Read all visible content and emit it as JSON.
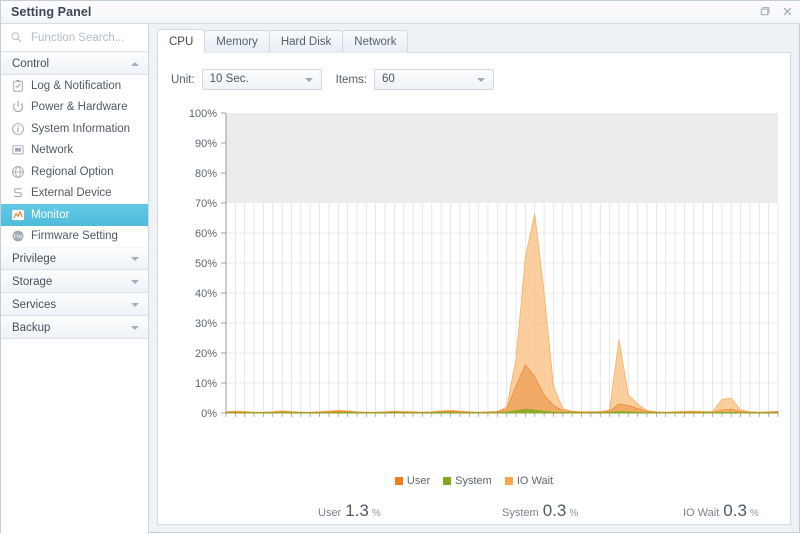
{
  "window": {
    "title": "Setting Panel",
    "buttons": [
      {
        "name": "restore-button",
        "icon": "restore-icon"
      },
      {
        "name": "close-button",
        "icon": "close-icon"
      }
    ]
  },
  "sidebar": {
    "search": {
      "placeholder": "Function Search...",
      "value": "",
      "icon": "search-icon"
    },
    "groups": [
      {
        "label": "Control",
        "expanded": true,
        "caret": "caret-up",
        "items": [
          {
            "label": "Log & Notification",
            "icon": "clipboard-check-icon",
            "selected": false
          },
          {
            "label": "Power & Hardware",
            "icon": "power-icon",
            "selected": false
          },
          {
            "label": "System Information",
            "icon": "info-circle-icon",
            "selected": false
          },
          {
            "label": "Network",
            "icon": "network-icon",
            "selected": false
          },
          {
            "label": "Regional Option",
            "icon": "globe-icon",
            "selected": false
          },
          {
            "label": "External Device",
            "icon": "usb-icon",
            "selected": false
          },
          {
            "label": "Monitor",
            "icon": "chart-line-icon",
            "selected": true
          },
          {
            "label": "Firmware Setting",
            "icon": "firmware-icon",
            "selected": false
          }
        ]
      },
      {
        "label": "Privilege",
        "expanded": false,
        "caret": "caret-down",
        "items": []
      },
      {
        "label": "Storage",
        "expanded": false,
        "caret": "caret-down",
        "items": []
      },
      {
        "label": "Services",
        "expanded": false,
        "caret": "caret-down",
        "items": []
      },
      {
        "label": "Backup",
        "expanded": false,
        "caret": "caret-down",
        "items": []
      }
    ]
  },
  "main": {
    "tabs": [
      {
        "label": "CPU",
        "active": true
      },
      {
        "label": "Memory",
        "active": false
      },
      {
        "label": "Hard Disk",
        "active": false
      },
      {
        "label": "Network",
        "active": false
      }
    ],
    "controls": {
      "unit_label": "Unit:",
      "unit_value": "10 Sec.",
      "items_label": "Items:",
      "items_value": "60"
    },
    "stats": [
      {
        "name": "User",
        "value": "1.3",
        "unit": "%"
      },
      {
        "name": "System",
        "value": "0.3",
        "unit": "%"
      },
      {
        "name": "IO Wait",
        "value": "0.3",
        "unit": "%"
      }
    ]
  },
  "colors": {
    "user": "#EE7C22",
    "system": "#7DAA1E",
    "iowait": "#F8A64B",
    "iowait_fill": "#F9C68C",
    "user_fill": "#F0A259",
    "accent": "#4FBCDC",
    "band": "#ECECEC",
    "grid": "#E2E2E2",
    "axis": "#808080"
  },
  "chart_data": {
    "type": "area",
    "title": "",
    "xlabel": "",
    "ylabel": "",
    "ylim": [
      0,
      100
    ],
    "ytick_labels": [
      "0%",
      "10%",
      "20%",
      "30%",
      "40%",
      "50%",
      "60%",
      "70%",
      "80%",
      "90%",
      "100%"
    ],
    "ytick_values": [
      0,
      10,
      20,
      30,
      40,
      50,
      60,
      70,
      80,
      90,
      100
    ],
    "grid": true,
    "shaded_band": [
      70,
      100
    ],
    "legend_position": "bottom",
    "unit": "10 Sec.",
    "points": 60,
    "x": [
      1,
      2,
      3,
      4,
      5,
      6,
      7,
      8,
      9,
      10,
      11,
      12,
      13,
      14,
      15,
      16,
      17,
      18,
      19,
      20,
      21,
      22,
      23,
      24,
      25,
      26,
      27,
      28,
      29,
      30,
      31,
      32,
      33,
      34,
      35,
      36,
      37,
      38,
      39,
      40,
      41,
      42,
      43,
      44,
      45,
      46,
      47,
      48,
      49,
      50,
      51,
      52,
      53,
      54,
      55,
      56,
      57,
      58,
      59,
      60
    ],
    "series": [
      {
        "name": "IO Wait",
        "color": "#F8A64B",
        "values": [
          0.4,
          0.6,
          0.5,
          0.3,
          0.3,
          0.4,
          0.8,
          0.5,
          0.3,
          0.3,
          0.4,
          0.6,
          0.9,
          0.7,
          0.4,
          0.3,
          0.3,
          0.4,
          0.6,
          0.5,
          0.4,
          0.3,
          0.4,
          0.7,
          0.9,
          0.6,
          0.4,
          0.3,
          0.4,
          0.5,
          2.0,
          18.0,
          52.0,
          66.5,
          40.0,
          9.0,
          1.5,
          0.6,
          0.4,
          0.4,
          0.5,
          1.0,
          24.5,
          6.0,
          3.0,
          0.8,
          0.4,
          0.3,
          0.4,
          0.5,
          0.6,
          0.5,
          0.4,
          4.5,
          5.0,
          1.0,
          0.4,
          0.3,
          0.4,
          0.5
        ]
      },
      {
        "name": "User",
        "color": "#EE7C22",
        "values": [
          0.3,
          0.4,
          0.3,
          0.2,
          0.2,
          0.3,
          0.5,
          0.3,
          0.2,
          0.2,
          0.3,
          0.4,
          0.6,
          0.5,
          0.3,
          0.2,
          0.2,
          0.3,
          0.4,
          0.3,
          0.3,
          0.2,
          0.3,
          0.5,
          0.6,
          0.4,
          0.3,
          0.2,
          0.3,
          0.4,
          1.2,
          9.0,
          16.0,
          12.0,
          6.0,
          2.5,
          0.8,
          0.4,
          0.3,
          0.3,
          0.3,
          0.6,
          3.0,
          2.5,
          1.5,
          0.5,
          0.3,
          0.2,
          0.3,
          0.4,
          0.4,
          0.3,
          0.3,
          1.0,
          1.2,
          0.5,
          0.3,
          0.2,
          0.3,
          0.4
        ]
      },
      {
        "name": "System",
        "color": "#7DAA1E",
        "values": [
          0.1,
          0.1,
          0.1,
          0.1,
          0.1,
          0.1,
          0.2,
          0.1,
          0.1,
          0.1,
          0.1,
          0.1,
          0.2,
          0.2,
          0.1,
          0.1,
          0.1,
          0.1,
          0.2,
          0.1,
          0.1,
          0.1,
          0.1,
          0.2,
          0.2,
          0.1,
          0.1,
          0.1,
          0.1,
          0.1,
          0.3,
          0.8,
          1.2,
          1.0,
          0.6,
          0.3,
          0.2,
          0.1,
          0.1,
          0.1,
          0.1,
          0.2,
          0.5,
          0.4,
          0.2,
          0.1,
          0.1,
          0.1,
          0.1,
          0.1,
          0.1,
          0.1,
          0.1,
          0.2,
          0.2,
          0.1,
          0.1,
          0.1,
          0.1,
          0.1
        ]
      }
    ],
    "legend": [
      {
        "label": "User",
        "color": "#EE7C22"
      },
      {
        "label": "System",
        "color": "#7DAA1E"
      },
      {
        "label": "IO Wait",
        "color": "#F8A64B"
      }
    ]
  }
}
